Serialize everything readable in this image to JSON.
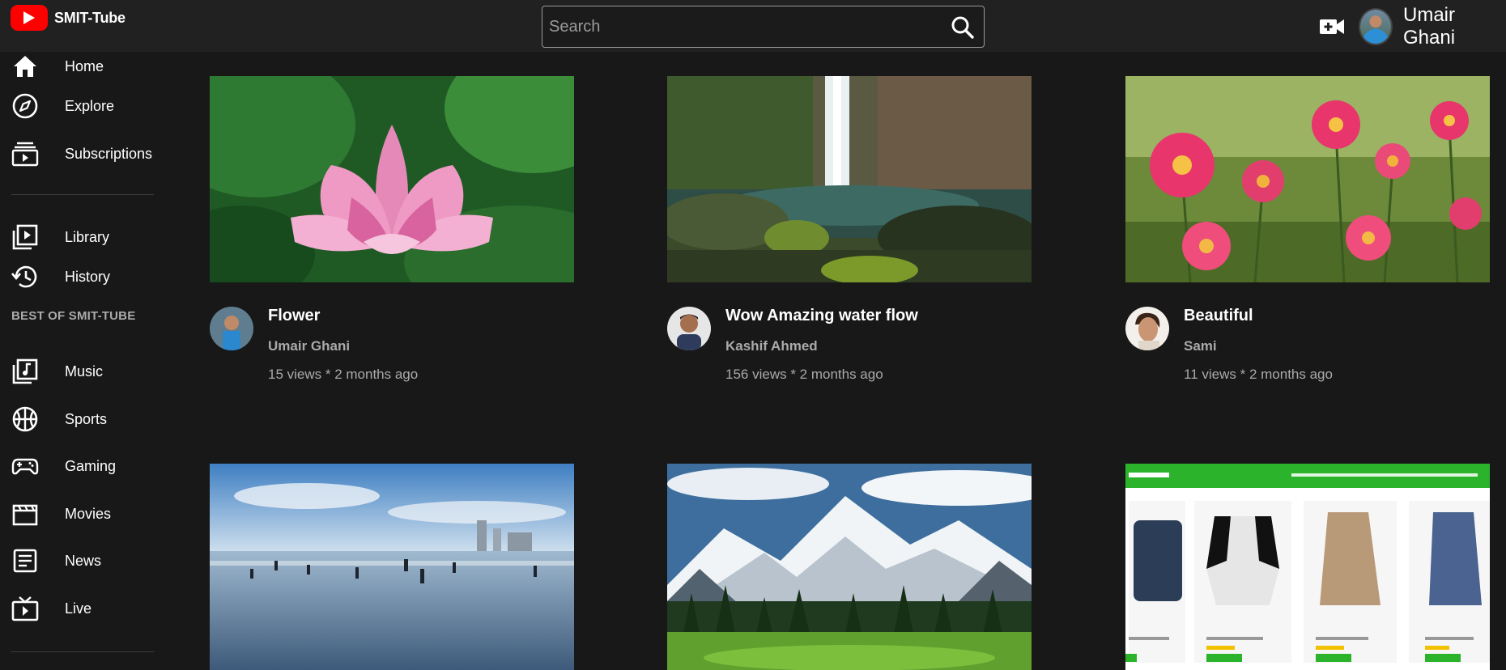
{
  "app": {
    "name": "SMIT-Tube",
    "brand_color": "#ff0000"
  },
  "search": {
    "placeholder": "Search"
  },
  "user": {
    "first_name": "Umair",
    "last_name": "Ghani"
  },
  "sidebar": {
    "main_items": [
      {
        "label": "Home",
        "icon": "home-icon"
      },
      {
        "label": "Explore",
        "icon": "compass-icon"
      },
      {
        "label": "Subscriptions",
        "icon": "subscriptions-icon"
      }
    ],
    "library_items": [
      {
        "label": "Library",
        "icon": "library-icon"
      },
      {
        "label": "History",
        "icon": "history-icon"
      }
    ],
    "section_title": "BEST OF SMIT-TUBE",
    "best_items": [
      {
        "label": "Music",
        "icon": "music-icon"
      },
      {
        "label": "Sports",
        "icon": "sports-icon"
      },
      {
        "label": "Gaming",
        "icon": "gamepad-icon"
      },
      {
        "label": "Movies",
        "icon": "movies-icon"
      },
      {
        "label": "News",
        "icon": "news-icon"
      },
      {
        "label": "Live",
        "icon": "live-icon"
      }
    ]
  },
  "videos": [
    {
      "title": "Flower",
      "channel": "Umair Ghani",
      "meta": "15 views * 2 months ago",
      "thumbnail": "pink-lotus-flower"
    },
    {
      "title": "Wow Amazing water flow",
      "channel": "Kashif Ahmed",
      "meta": "156 views * 2 months ago",
      "thumbnail": "waterfall"
    },
    {
      "title": "Beautiful",
      "channel": "Sami",
      "meta": "11 views * 2 months ago",
      "thumbnail": "pink-dahlia-flowers"
    },
    {
      "thumbnail": "beach-shore"
    },
    {
      "thumbnail": "snowy-mountains-meadow"
    },
    {
      "thumbnail": "store-website-screenshot"
    }
  ]
}
